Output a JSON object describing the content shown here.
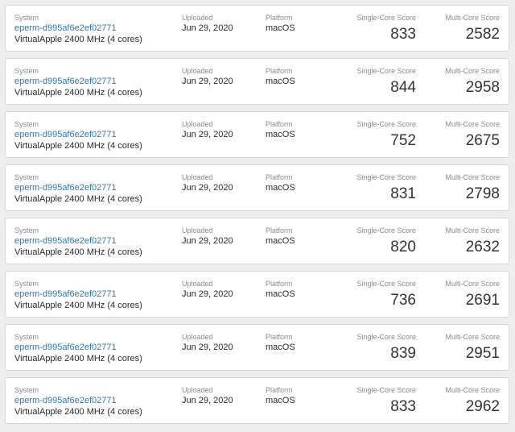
{
  "labels": {
    "system": "System",
    "uploaded": "Uploaded",
    "platform": "Platform",
    "single_core": "Single-Core Score",
    "multi_core": "Multi-Core Score"
  },
  "colors": {
    "link": "#2b77b8",
    "label": "#8a8a8a",
    "text": "#2a2a2a",
    "background": "#eeeeee",
    "card": "#ffffff"
  },
  "results": [
    {
      "system": "eperm-d995af6e2ef02771",
      "processor": "VirtualApple 2400 MHz (4 cores)",
      "uploaded": "Jun 29, 2020",
      "platform": "macOS",
      "single_core": "833",
      "multi_core": "2582"
    },
    {
      "system": "eperm-d995af6e2ef02771",
      "processor": "VirtualApple 2400 MHz (4 cores)",
      "uploaded": "Jun 29, 2020",
      "platform": "macOS",
      "single_core": "844",
      "multi_core": "2958"
    },
    {
      "system": "eperm-d995af6e2ef02771",
      "processor": "VirtualApple 2400 MHz (4 cores)",
      "uploaded": "Jun 29, 2020",
      "platform": "macOS",
      "single_core": "752",
      "multi_core": "2675"
    },
    {
      "system": "eperm-d995af6e2ef02771",
      "processor": "VirtualApple 2400 MHz (4 cores)",
      "uploaded": "Jun 29, 2020",
      "platform": "macOS",
      "single_core": "831",
      "multi_core": "2798"
    },
    {
      "system": "eperm-d995af6e2ef02771",
      "processor": "VirtualApple 2400 MHz (4 cores)",
      "uploaded": "Jun 29, 2020",
      "platform": "macOS",
      "single_core": "820",
      "multi_core": "2632"
    },
    {
      "system": "eperm-d995af6e2ef02771",
      "processor": "VirtualApple 2400 MHz (4 cores)",
      "uploaded": "Jun 29, 2020",
      "platform": "macOS",
      "single_core": "736",
      "multi_core": "2691"
    },
    {
      "system": "eperm-d995af6e2ef02771",
      "processor": "VirtualApple 2400 MHz (4 cores)",
      "uploaded": "Jun 29, 2020",
      "platform": "macOS",
      "single_core": "839",
      "multi_core": "2951"
    },
    {
      "system": "eperm-d995af6e2ef02771",
      "processor": "VirtualApple 2400 MHz (4 cores)",
      "uploaded": "Jun 29, 2020",
      "platform": "macOS",
      "single_core": "833",
      "multi_core": "2962"
    }
  ]
}
